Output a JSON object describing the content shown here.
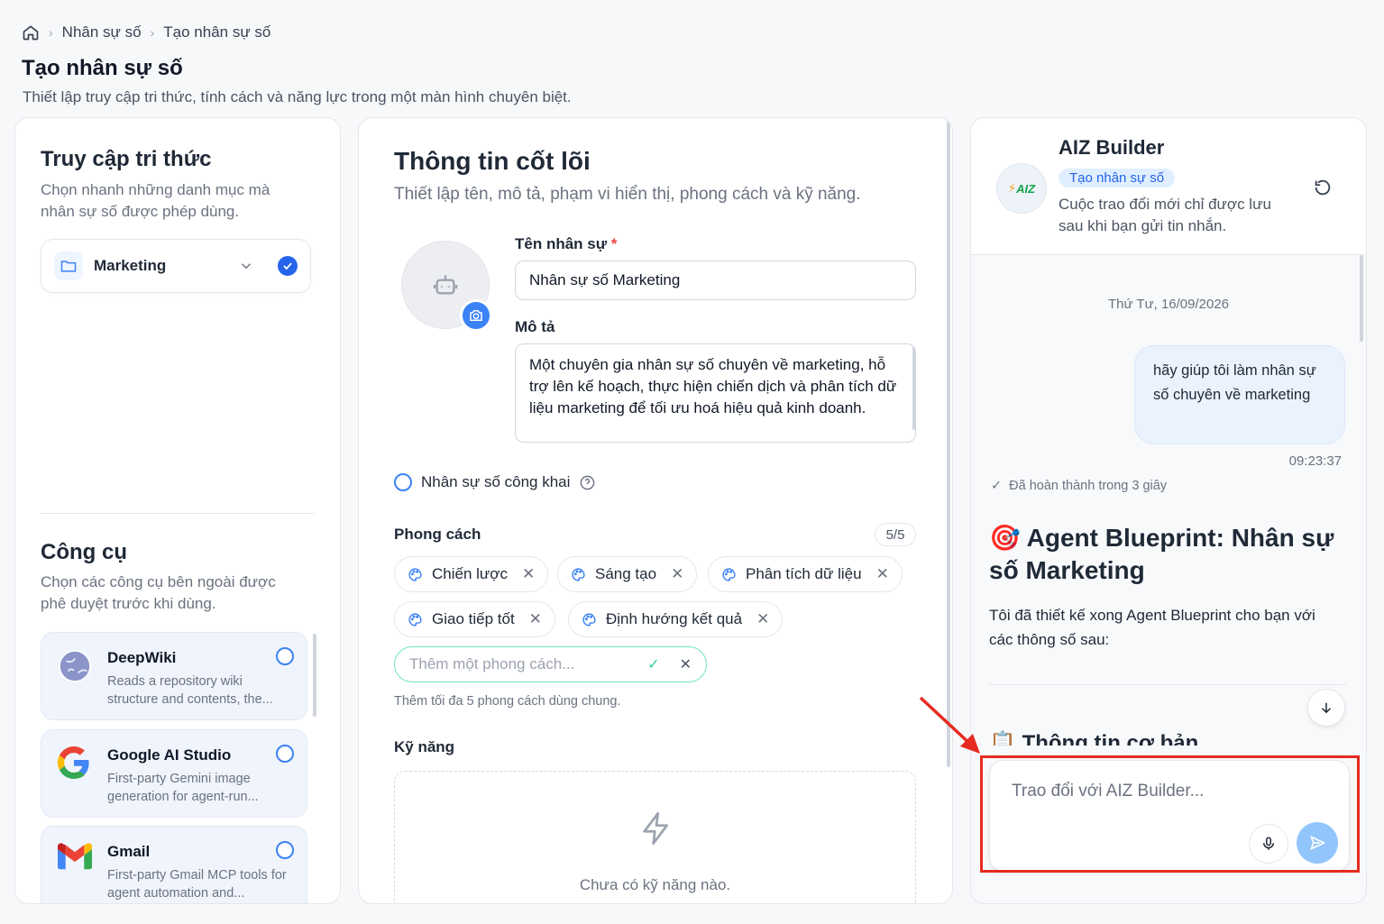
{
  "breadcrumb": {
    "home_icon": "home-icon",
    "items": [
      "Nhân sự số",
      "Tạo nhân sự số"
    ]
  },
  "page": {
    "title": "Tạo nhân sự số",
    "subtitle": "Thiết lập truy cập tri thức, tính cách và năng lực trong một màn hình chuyên biệt."
  },
  "knowledge": {
    "title": "Truy cập tri thức",
    "desc_line1": "Chọn nhanh những danh mục mà",
    "desc_line2": "nhân sự số được phép dùng.",
    "selected": "Marketing"
  },
  "tools": {
    "title": "Công cụ",
    "desc_line1": "Chọn các công cụ bên ngoài được",
    "desc_line2": "phê duyệt trước khi dùng.",
    "items": [
      {
        "name": "DeepWiki",
        "desc": "Reads a repository wiki structure and contents, the..."
      },
      {
        "name": "Google AI Studio",
        "desc": "First-party Gemini image generation for agent-run..."
      },
      {
        "name": "Gmail",
        "desc": "First-party Gmail MCP tools for agent automation and..."
      }
    ]
  },
  "core": {
    "title": "Thông tin cốt lõi",
    "subtitle": "Thiết lập tên, mô tả, phạm vi hiển thị, phong cách và kỹ năng.",
    "name_label": "Tên nhân sự",
    "required_mark": "*",
    "name_value": "Nhân sự số Marketing",
    "desc_label": "Mô tả",
    "desc_value": "Một chuyên gia nhân sự số chuyên về marketing, hỗ trợ lên kế hoạch, thực hiện chiến dịch và phân tích dữ liệu marketing để tối ưu hoá hiệu quả kinh doanh.",
    "public_label": "Nhân sự số công khai",
    "style_label": "Phong cách",
    "style_count": "5/5",
    "styles": [
      "Chiến lược",
      "Sáng tạo",
      "Phân tích dữ liệu",
      "Giao tiếp tốt",
      "Định hướng kết quả"
    ],
    "style_placeholder": "Thêm một phong cách...",
    "style_hint": "Thêm tối đa 5 phong cách dùng chung.",
    "skills_label": "Kỹ năng",
    "skills_empty": "Chưa có kỹ năng nào."
  },
  "chat": {
    "name": "AIZ Builder",
    "logo_text": "AIZ",
    "badge": "Tạo nhân sự số",
    "note_line1": "Cuộc trao đổi mới chỉ được lưu",
    "note_line2": "sau khi bạn gửi tin nhắn.",
    "date": "Thứ Tư, 16/09/2026",
    "user_message": "hãy giúp tôi làm nhân sự số chuyên về marketing",
    "time": "09:23:37",
    "status": "Đã hoàn thành trong 3 giây",
    "bp_emoji": "🎯",
    "bp_line1": "Agent Blueprint: Nhân sự",
    "bp_line2": "số Marketing",
    "reply_line1": "Tôi đã thiết kế xong Agent Blueprint cho bạn với",
    "reply_line2": "các thông số sau:",
    "section_emoji": "📋",
    "section_title": "Thông tin cơ bản",
    "input_placeholder": "Trao đổi với AIZ Builder..."
  },
  "colors": {
    "accent": "#3b82f6",
    "highlight": "#e52b20",
    "send": "#93c5fd",
    "chip_focus": "#6ee7b7"
  }
}
